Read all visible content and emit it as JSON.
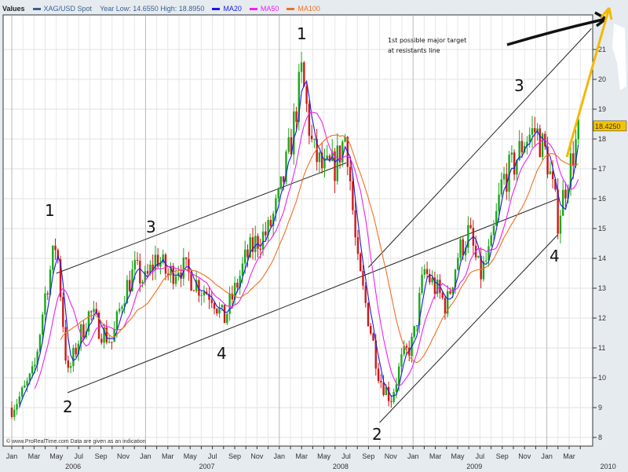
{
  "chart_data": {
    "type": "candlestick",
    "legend": {
      "title": "Values",
      "series_label": "XAG/USD Spot",
      "year_stats": "Year Low: 14.6550 High: 18.8950",
      "ma_labels": [
        "MA20",
        "MA50",
        "MA100"
      ]
    },
    "colors": {
      "spot": "#3b5f8f",
      "ma20": "#1a1ae6",
      "ma50": "#f020f0",
      "ma100": "#f07020",
      "up": "#1aa81a",
      "down": "#d01818",
      "last_price_bg": "#f5c400",
      "target_arrow": "#f5b800"
    },
    "moving_averages": [
      20,
      50,
      100
    ],
    "y_ticks": [
      8,
      9,
      10,
      11,
      12,
      13,
      14,
      15,
      16,
      17,
      18,
      19,
      20,
      21
    ],
    "ylim": [
      7.7,
      22.4
    ],
    "last_price": "18.4250",
    "x_month_labels": [
      "Jan",
      "Mar",
      "May",
      "Jul",
      "Sep",
      "Nov",
      "Jan",
      "Mar",
      "May",
      "Jul",
      "Sep",
      "Nov",
      "Jan",
      "Mar",
      "May",
      "Jul",
      "Sep",
      "Nov",
      "Jan",
      "Mar",
      "May",
      "Jul",
      "Sep",
      "Nov",
      "Jan",
      "Mar"
    ],
    "x_year_labels": [
      "2006",
      "2007",
      "2008",
      "2009",
      "2010"
    ],
    "price_path": [
      [
        "2006-01",
        9.0
      ],
      [
        "2006-02",
        9.5
      ],
      [
        "2006-03",
        10.2
      ],
      [
        "2006-04",
        12.8
      ],
      [
        "2006-05",
        14.6
      ],
      [
        "2006-06",
        10.0
      ],
      [
        "2006-07",
        11.3
      ],
      [
        "2006-08",
        12.2
      ],
      [
        "2006-09",
        11.6
      ],
      [
        "2006-10",
        11.2
      ],
      [
        "2006-11",
        12.8
      ],
      [
        "2006-12",
        13.6
      ],
      [
        "2007-01",
        13.2
      ],
      [
        "2007-02",
        14.1
      ],
      [
        "2007-03",
        13.4
      ],
      [
        "2007-04",
        13.8
      ],
      [
        "2007-05",
        13.4
      ],
      [
        "2007-06",
        13.0
      ],
      [
        "2007-07",
        12.8
      ],
      [
        "2007-08",
        11.9
      ],
      [
        "2007-09",
        12.9
      ],
      [
        "2007-10",
        14.0
      ],
      [
        "2007-11",
        14.6
      ],
      [
        "2007-12",
        14.9
      ],
      [
        "2008-01",
        16.0
      ],
      [
        "2008-02",
        17.8
      ],
      [
        "2008-03",
        20.2
      ],
      [
        "2008-04",
        17.6
      ],
      [
        "2008-05",
        16.9
      ],
      [
        "2008-06",
        17.1
      ],
      [
        "2008-07",
        18.2
      ],
      [
        "2008-08",
        13.8
      ],
      [
        "2008-09",
        12.0
      ],
      [
        "2008-10",
        10.0
      ],
      [
        "2008-11",
        9.3
      ],
      [
        "2008-12",
        10.6
      ],
      [
        "2009-01",
        11.2
      ],
      [
        "2009-02",
        13.6
      ],
      [
        "2009-03",
        13.0
      ],
      [
        "2009-04",
        12.4
      ],
      [
        "2009-05",
        14.1
      ],
      [
        "2009-06",
        14.9
      ],
      [
        "2009-07",
        13.4
      ],
      [
        "2009-08",
        14.3
      ],
      [
        "2009-09",
        16.6
      ],
      [
        "2009-10",
        17.1
      ],
      [
        "2009-11",
        18.0
      ],
      [
        "2009-12",
        18.3
      ],
      [
        "2010-01",
        17.4
      ],
      [
        "2010-02",
        15.3
      ],
      [
        "2010-03",
        17.0
      ],
      [
        "2010-04",
        18.4
      ]
    ],
    "trendlines": [
      {
        "from": [
          "2006-05",
          13.5
        ],
        "to": [
          "2008-07",
          17.2
        ]
      },
      {
        "from": [
          "2006-06",
          9.5
        ],
        "to": [
          "2010-02",
          16.0
        ]
      },
      {
        "from": [
          "2008-09",
          13.7
        ],
        "to": [
          "2010-05",
          21.7
        ]
      },
      {
        "from": [
          "2008-10",
          8.5
        ],
        "to": [
          "2010-02",
          14.8
        ]
      }
    ],
    "wave_labels": [
      "1",
      "2",
      "3",
      "4",
      "1",
      "2",
      "3",
      "4"
    ],
    "annotation": [
      "1st possible major target",
      "at resistants line"
    ],
    "footer": "© www.ProRealTime.com Data are given as an indication",
    "grid": true
  }
}
